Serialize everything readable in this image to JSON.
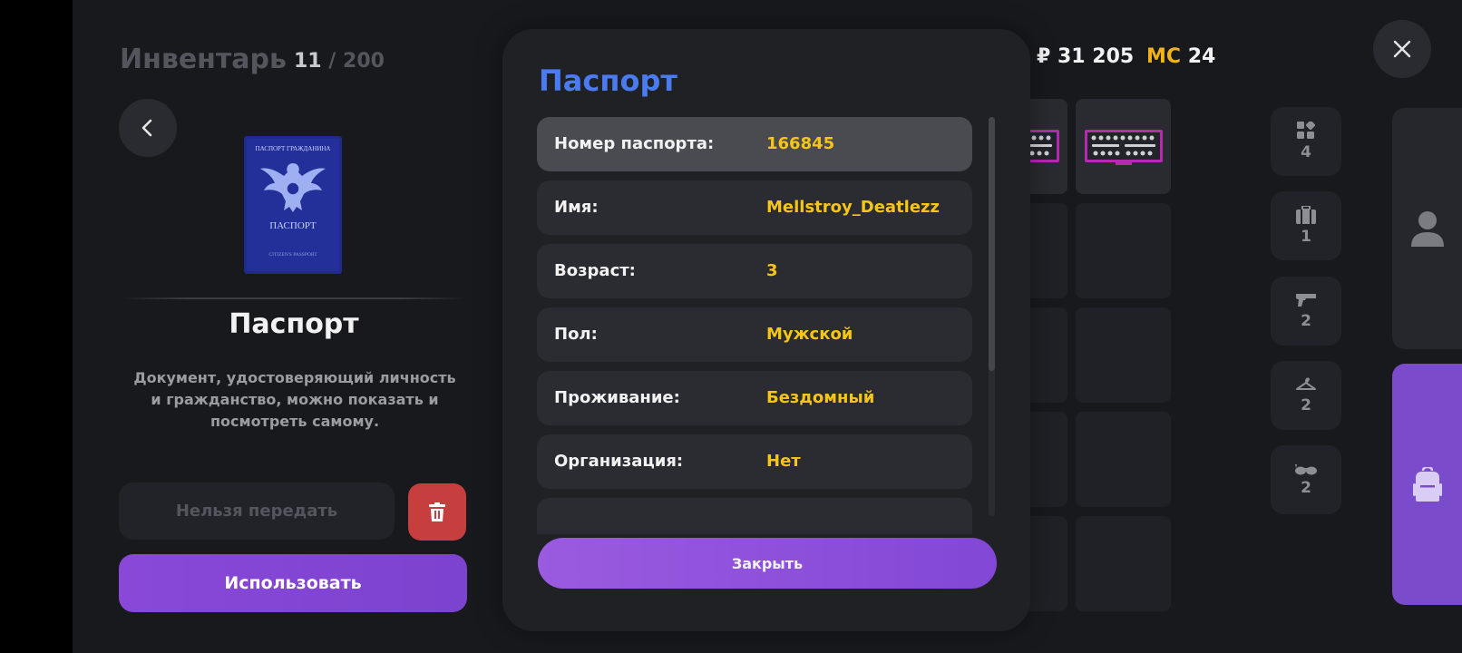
{
  "inventory": {
    "title": "Инвентарь",
    "count": "11",
    "separator": "/",
    "max": "200",
    "back_icon": "chevron-left-icon"
  },
  "item": {
    "image_label_top": "ПАСПОРТ ГРАЖДАНИНА",
    "image_label_middle": "ПАСПОРТ",
    "image_label_bottom": "CITIZEN'S PASSPORT",
    "name": "Паспорт",
    "description": "Документ, удостоверяющий личность и гражданство, можно показать и посмотреть самому.",
    "no_transfer_label": "Нельзя передать",
    "delete_icon": "trash-icon",
    "use_label": "Использовать"
  },
  "currency": {
    "rub_symbol": "₽",
    "rub_value": "31 205",
    "mc_label": "MC",
    "mc_value": "24"
  },
  "categories": [
    {
      "icon": "grid-icon",
      "count": "4"
    },
    {
      "icon": "suitcase-icon",
      "count": "1"
    },
    {
      "icon": "pistol-icon",
      "count": "2"
    },
    {
      "icon": "hanger-icon",
      "count": "2"
    },
    {
      "icon": "glasses-icon",
      "count": "2"
    }
  ],
  "side_tabs": [
    {
      "icon": "user-icon",
      "active": false
    },
    {
      "icon": "backpack-icon",
      "active": true
    }
  ],
  "modal": {
    "title": "Паспорт",
    "rows": [
      {
        "key": "Номер паспорта:",
        "value": "166845"
      },
      {
        "key": "Имя:",
        "value": "Mellstroy_Deatlezz"
      },
      {
        "key": "Возраст:",
        "value": "3"
      },
      {
        "key": "Пол:",
        "value": "Мужской"
      },
      {
        "key": "Проживание:",
        "value": "Бездомный"
      },
      {
        "key": "Организация:",
        "value": "Нет"
      }
    ],
    "close_label": "Закрыть"
  },
  "colors": {
    "accent_purple": "#8a48d8",
    "title_blue": "#4a7bf1",
    "value_yellow": "#f5c518",
    "mc_gold": "#f2b21a",
    "danger_red": "#c73e3e"
  }
}
